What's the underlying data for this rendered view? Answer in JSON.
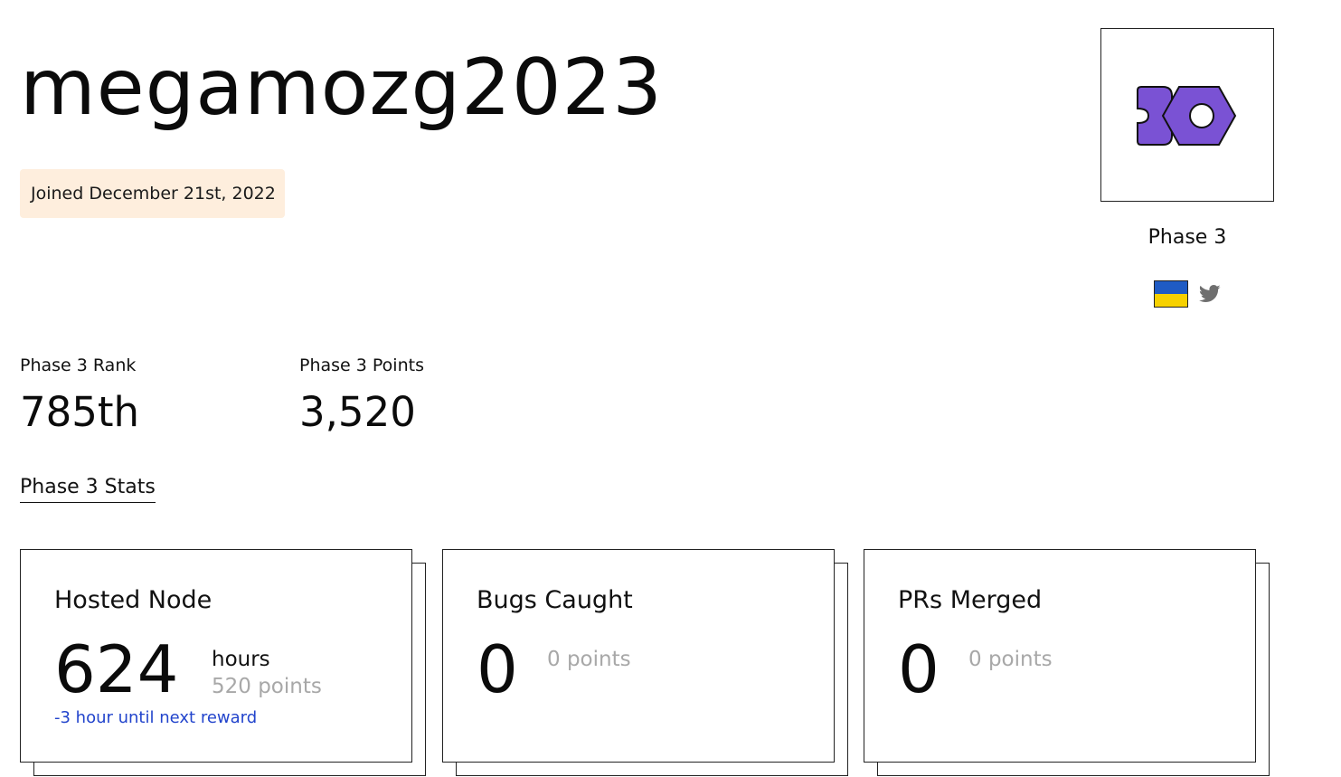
{
  "profile": {
    "username": "megamozg2023",
    "joined": "Joined December 21st, 2022",
    "phase_label": "Phase 3",
    "avatar_color": "#7a52d4"
  },
  "stats": {
    "rank_label": "Phase 3 Rank",
    "rank_value": "785th",
    "points_label": "Phase 3 Points",
    "points_value": "3,520",
    "tab_label": "Phase 3 Stats"
  },
  "cards": [
    {
      "title": "Hosted Node",
      "value": "624",
      "unit": "hours",
      "points": "520 points",
      "next_reward": "-3 hour until next reward"
    },
    {
      "title": "Bugs Caught",
      "value": "0",
      "points": "0 points"
    },
    {
      "title": "PRs Merged",
      "value": "0",
      "points": "0 points"
    }
  ],
  "icons": {
    "flag": "ukraine-flag-icon",
    "twitter": "twitter-icon",
    "avatar": "logo-icon"
  },
  "colors": {
    "joined_bg": "#feeedd",
    "link_blue": "#2244cc",
    "muted": "#a8a8a8",
    "flag_blue": "#1f5bc4",
    "flag_yellow": "#f7d100"
  }
}
